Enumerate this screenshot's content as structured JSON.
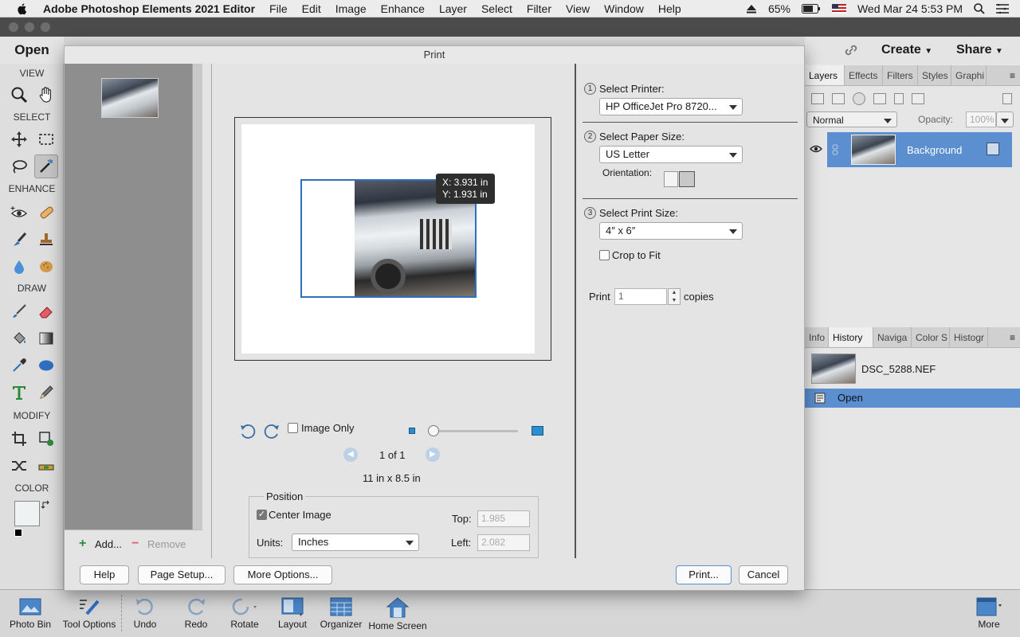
{
  "menubar": {
    "app_name": "Adobe Photoshop Elements 2021 Editor",
    "items": [
      "File",
      "Edit",
      "Image",
      "Enhance",
      "Layer",
      "Select",
      "Filter",
      "View",
      "Window",
      "Help"
    ],
    "battery": "65%",
    "datetime": "Wed Mar 24  5:53 PM"
  },
  "app": {
    "open_label": "Open",
    "create_label": "Create",
    "share_label": "Share"
  },
  "toolbox": {
    "view": "VIEW",
    "select": "SELECT",
    "enhance": "ENHANCE",
    "draw": "DRAW",
    "modify": "MODIFY",
    "color": "COLOR"
  },
  "layers_panel": {
    "tabs": [
      "Layers",
      "Effects",
      "Filters",
      "Styles",
      "Graphi"
    ],
    "blend_mode": "Normal",
    "opacity_label": "Opacity:",
    "opacity_value": "100%",
    "layer_name": "Background"
  },
  "history_panel": {
    "tabs": [
      "Info",
      "History",
      "Naviga",
      "Color S",
      "Histogr"
    ],
    "file_name": "DSC_5288.NEF",
    "step": "Open"
  },
  "dialog": {
    "title": "Print",
    "add_label": "Add...",
    "remove_label": "Remove",
    "tooltip_x": "X: 3.931 in",
    "tooltip_y": "Y: 1.931 in",
    "image_only_label": "Image Only",
    "page_counter": "1 of 1",
    "paper_dims": "11 in x 8.5 in",
    "position": {
      "legend": "Position",
      "center_image_label": "Center Image",
      "units_label": "Units:",
      "units_value": "Inches",
      "top_label": "Top:",
      "top_value": "1.985",
      "left_label": "Left:",
      "left_value": "2.082"
    },
    "steps": {
      "printer_label": "Select Printer:",
      "printer_value": "HP OfficeJet Pro 8720...",
      "paper_label": "Select Paper Size:",
      "paper_value": "US Letter",
      "orientation_label": "Orientation:",
      "size_label": "Select Print Size:",
      "size_value": "4″ x 6″",
      "crop_label": "Crop to Fit",
      "print_label": "Print",
      "copies_value": "1",
      "copies_label": "copies",
      "n1": "1",
      "n2": "2",
      "n3": "3"
    },
    "buttons": {
      "help": "Help",
      "page_setup": "Page Setup...",
      "more_options": "More Options...",
      "print": "Print...",
      "cancel": "Cancel"
    }
  },
  "bottombar": {
    "photo_bin": "Photo Bin",
    "tool_options": "Tool Options",
    "undo": "Undo",
    "redo": "Redo",
    "rotate": "Rotate",
    "layout": "Layout",
    "organizer": "Organizer",
    "home_screen": "Home Screen",
    "more": "More"
  },
  "colors": {
    "accent_blue": "#2f6fc0",
    "selected_layer": "#5b8fd0"
  }
}
